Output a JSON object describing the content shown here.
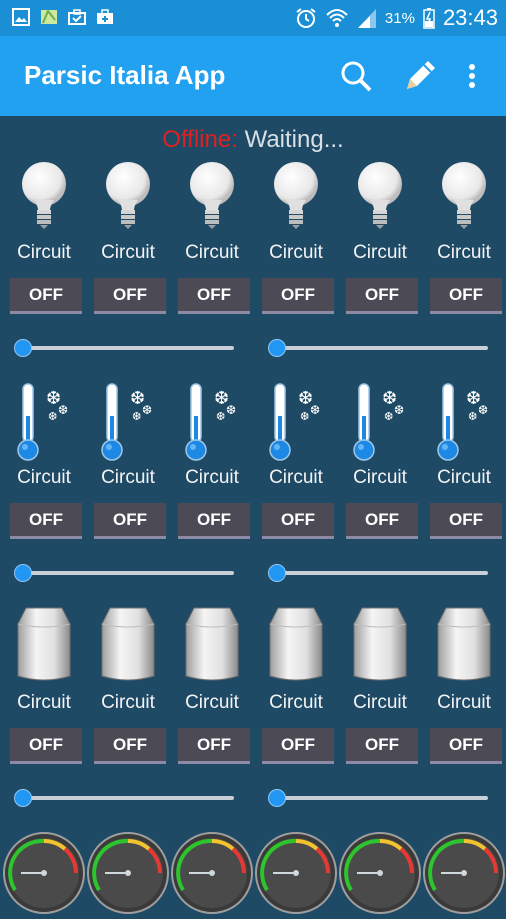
{
  "status_bar": {
    "left_icons": [
      "gallery-icon",
      "map-icon",
      "briefcase-check-icon",
      "briefcase-plus-icon"
    ],
    "right_icons": [
      "alarm-icon",
      "wifi-icon",
      "signal-icon",
      "battery-charging-icon"
    ],
    "battery": "31%",
    "time": "23:43"
  },
  "app_bar": {
    "title": "Parsic Italia App",
    "actions": [
      "search-icon",
      "pencil-icon",
      "overflow-menu-icon"
    ]
  },
  "connection": {
    "state": "Offline:",
    "message": "Waiting..."
  },
  "sections": [
    {
      "device": "light-bulb-icon",
      "circuits": [
        {
          "label": "Circuit",
          "button": "OFF"
        },
        {
          "label": "Circuit",
          "button": "OFF"
        },
        {
          "label": "Circuit",
          "button": "OFF"
        },
        {
          "label": "Circuit",
          "button": "OFF"
        },
        {
          "label": "Circuit",
          "button": "OFF"
        },
        {
          "label": "Circuit",
          "button": "OFF"
        }
      ],
      "sliders": [
        0,
        0
      ]
    },
    {
      "device": "thermometer-snowflake-icon",
      "circuits": [
        {
          "label": "Circuit",
          "button": "OFF"
        },
        {
          "label": "Circuit",
          "button": "OFF"
        },
        {
          "label": "Circuit",
          "button": "OFF"
        },
        {
          "label": "Circuit",
          "button": "OFF"
        },
        {
          "label": "Circuit",
          "button": "OFF"
        },
        {
          "label": "Circuit",
          "button": "OFF"
        }
      ],
      "sliders": [
        0,
        0
      ]
    },
    {
      "device": "shutter-cylinder-icon",
      "circuits": [
        {
          "label": "Circuit",
          "button": "OFF"
        },
        {
          "label": "Circuit",
          "button": "OFF"
        },
        {
          "label": "Circuit",
          "button": "OFF"
        },
        {
          "label": "Circuit",
          "button": "OFF"
        },
        {
          "label": "Circuit",
          "button": "OFF"
        },
        {
          "label": "Circuit",
          "button": "OFF"
        }
      ],
      "sliders": [
        0,
        0
      ]
    }
  ],
  "gauges": [
    "gauge-icon",
    "gauge-icon",
    "gauge-icon",
    "gauge-icon",
    "gauge-icon",
    "gauge-icon"
  ],
  "colors": {
    "background": "#1f4a66",
    "app_bar": "#21a1f0",
    "status_bar": "#1a8fd6",
    "offline": "#e02020",
    "button": "#4c4a55",
    "slider_thumb": "#2196f3"
  }
}
